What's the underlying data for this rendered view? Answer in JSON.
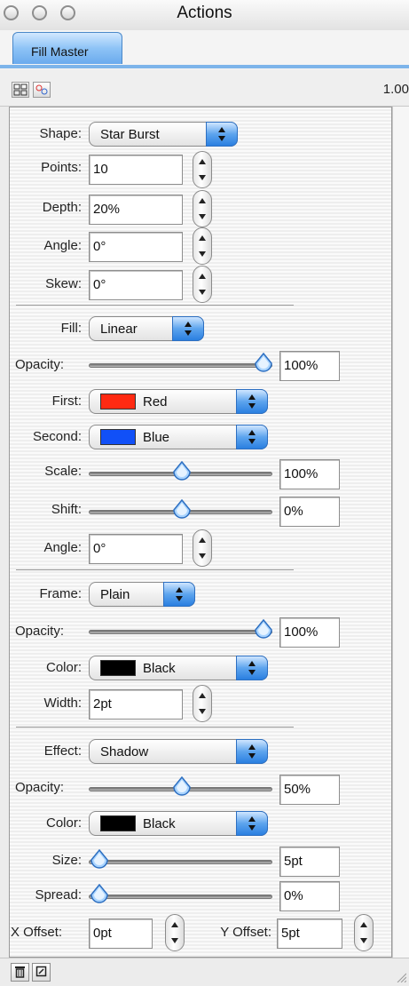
{
  "window": {
    "title": "Actions"
  },
  "tabs": {
    "active": "Fill Master"
  },
  "toolbar": {
    "zoom": "1.00"
  },
  "shape": {
    "shape_label": "Shape:",
    "shape_value": "Star Burst",
    "points_label": "Points:",
    "points_value": "10",
    "depth_label": "Depth:",
    "depth_value": "20%",
    "angle_label": "Angle:",
    "angle_value": "0°",
    "skew_label": "Skew:",
    "skew_value": "0°"
  },
  "fill": {
    "fill_label": "Fill:",
    "fill_value": "Linear",
    "opacity_label": "Opacity:",
    "opacity_value": "100%",
    "opacity_level": 1.0,
    "first_label": "First:",
    "first_value": "Red",
    "first_color": "#ff2a12",
    "second_label": "Second:",
    "second_value": "Blue",
    "second_color": "#1150f7",
    "scale_label": "Scale:",
    "scale_value": "100%",
    "scale_level": 0.5,
    "shift_label": "Shift:",
    "shift_value": "0%",
    "shift_level": 0.5,
    "angle_label": "Angle:",
    "angle_value": "0°"
  },
  "frame": {
    "frame_label": "Frame:",
    "frame_value": "Plain",
    "opacity_label": "Opacity:",
    "opacity_value": "100%",
    "opacity_level": 1.0,
    "color_label": "Color:",
    "color_value": "Black",
    "color_swatch": "#000000",
    "width_label": "Width:",
    "width_value": "2pt"
  },
  "effect": {
    "effect_label": "Effect:",
    "effect_value": "Shadow",
    "opacity_label": "Opacity:",
    "opacity_value": "50%",
    "opacity_level": 0.5,
    "color_label": "Color:",
    "color_value": "Black",
    "color_swatch": "#000000",
    "size_label": "Size:",
    "size_value": "5pt",
    "size_level": 0.0,
    "spread_label": "Spread:",
    "spread_value": "0%",
    "spread_level": 0.0,
    "xoffset_label": "X Offset:",
    "xoffset_value": "0pt",
    "yoffset_label": "Y Offset:",
    "yoffset_value": "5pt"
  },
  "icons": {
    "toolbar_left": "grid-view-icon",
    "toolbar_right": "color-swap-icon",
    "bottom_left": "trash-icon",
    "bottom_right": "new-item-icon"
  },
  "colors": {
    "accent": "#5da4ee",
    "tab": "#8dc3f6"
  }
}
